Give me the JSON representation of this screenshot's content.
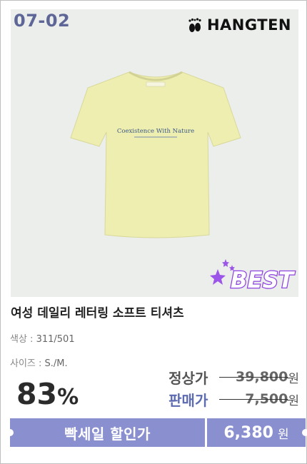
{
  "badge": {
    "code": "07-02"
  },
  "brand": {
    "name": "HANGTEN",
    "logo_icon": "footprint-icon"
  },
  "product": {
    "print_text": "Coexistence With Nature",
    "title": "여성 데일리 레터링 소프트 티셔츠",
    "color_label": "색상 :",
    "color_value": "311/501",
    "size_label": "사이즈 :",
    "size_value": "S./M.",
    "shirt_color": "#eeeeb0"
  },
  "best_label": "BEST",
  "pricing": {
    "discount_value": "83",
    "discount_unit": "%",
    "regular_label": "정상가",
    "regular_price": "39,800",
    "sale_label": "판매가",
    "sale_price": "7,500",
    "won": "원"
  },
  "promo": {
    "label": "빡세일 할인가",
    "price": "6,380",
    "won": "원",
    "color": "#8a90cf"
  }
}
